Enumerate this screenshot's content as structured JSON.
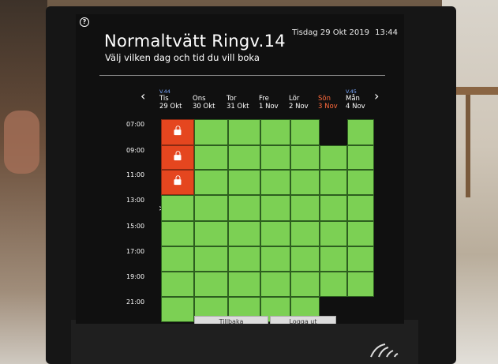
{
  "header": {
    "title": "Normaltvätt Ringv.14",
    "subtitle": "Välj vilken dag och tid du vill boka",
    "date": "Tisdag 29 Okt 2019",
    "time": "13:44"
  },
  "nav": {
    "prev": "‹",
    "next": "›"
  },
  "days": [
    {
      "week": "V.44",
      "day": "Tis",
      "date": "29 Okt",
      "weekend": false
    },
    {
      "week": "",
      "day": "Ons",
      "date": "30 Okt",
      "weekend": false
    },
    {
      "week": "",
      "day": "Tor",
      "date": "31 Okt",
      "weekend": false
    },
    {
      "week": "",
      "day": "Fre",
      "date": "1 Nov",
      "weekend": false
    },
    {
      "week": "",
      "day": "Lör",
      "date": "2 Nov",
      "weekend": false
    },
    {
      "week": "",
      "day": "Sön",
      "date": "3 Nov",
      "weekend": true
    },
    {
      "week": "V.45",
      "day": "Mån",
      "date": "4 Nov",
      "weekend": false
    }
  ],
  "times": [
    "07:00",
    "09:00",
    "11:00",
    "13:00",
    "15:00",
    "17:00",
    "19:00",
    "21:00"
  ],
  "current_time_marker": ">",
  "booked_slots": [
    [
      0,
      0
    ],
    [
      0,
      1
    ],
    [
      0,
      2
    ]
  ],
  "buttons": {
    "back": "Tillbaka",
    "logout": "Logga ut"
  },
  "colors": {
    "available": "#7cd054",
    "booked": "#e5461f",
    "weekend": "#ff6a3c",
    "week": "#7aa7ff"
  }
}
